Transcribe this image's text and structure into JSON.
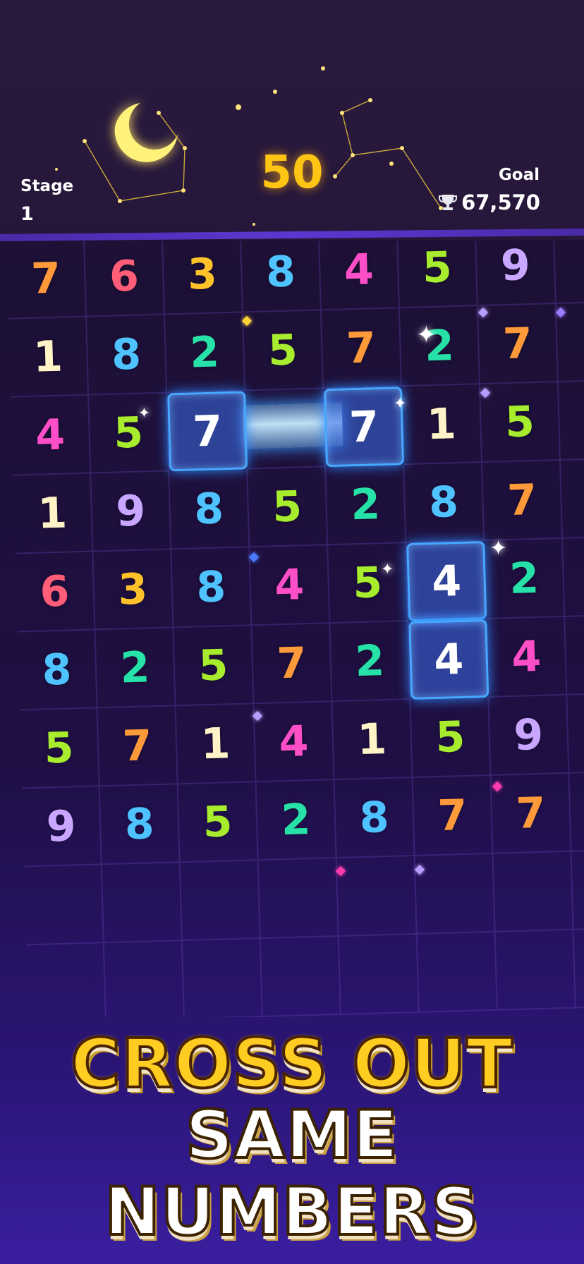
{
  "hud": {
    "stage_label": "Stage",
    "stage_value": "1",
    "score": "50",
    "goal_label": "Goal",
    "goal_value": "67,570"
  },
  "board": {
    "rows": [
      [
        "7",
        "6",
        "3",
        "8",
        "4",
        "5",
        "9"
      ],
      [
        "1",
        "8",
        "2",
        "5",
        "7",
        "2",
        "7"
      ],
      [
        "4",
        "5",
        "7",
        "",
        "7",
        "1",
        "5"
      ],
      [
        "1",
        "9",
        "8",
        "5",
        "2",
        "8",
        "7"
      ],
      [
        "6",
        "3",
        "8",
        "4",
        "5",
        "4",
        "2"
      ],
      [
        "8",
        "2",
        "5",
        "7",
        "2",
        "4",
        "4"
      ],
      [
        "5",
        "7",
        "1",
        "4",
        "1",
        "5",
        "9"
      ],
      [
        "9",
        "8",
        "5",
        "2",
        "8",
        "7",
        "7"
      ]
    ],
    "selected_pairs": [
      {
        "value": "7",
        "cells": [
          [
            2,
            2
          ],
          [
            2,
            4
          ]
        ]
      },
      {
        "value": "4",
        "cells": [
          [
            4,
            5
          ],
          [
            5,
            5
          ]
        ]
      }
    ]
  },
  "digit_colors": {
    "1": "#fff4c8",
    "2": "#27e2a8",
    "3": "#ffc22a",
    "4": "#ff4fc8",
    "5": "#a8ec2e",
    "6": "#ff5d78",
    "7": "#ff9a3a",
    "8": "#4ec3ff",
    "9": "#c9a6ff"
  },
  "banner": {
    "line1": "CROSS OUT",
    "line2": "SAME NUMBERS"
  }
}
